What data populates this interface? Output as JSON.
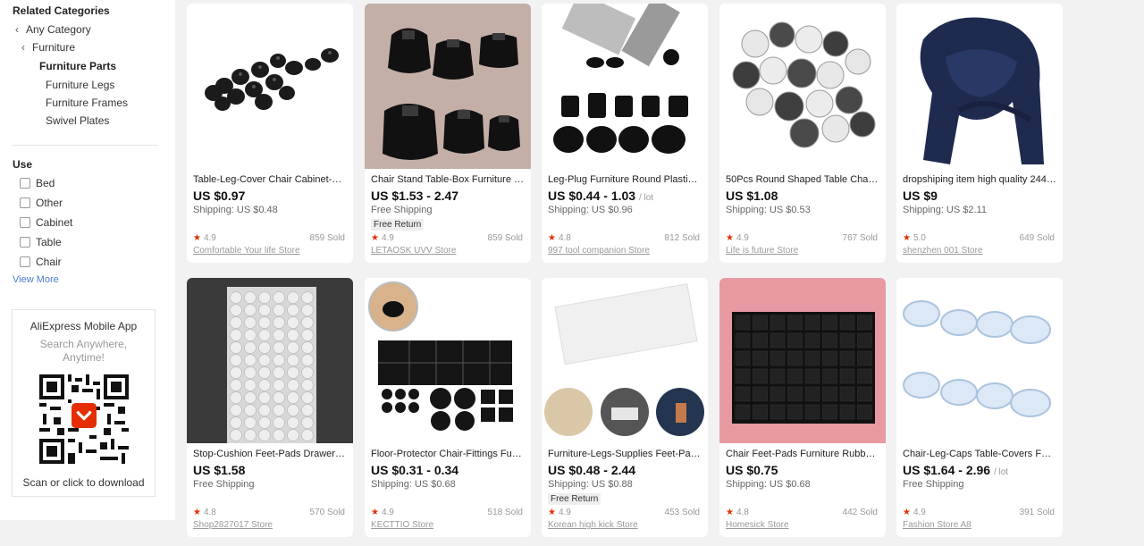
{
  "sidebar": {
    "related_title": "Related Categories",
    "categories": [
      {
        "label": "Any Category"
      },
      {
        "label": "Furniture"
      },
      {
        "label": "Furniture Parts"
      },
      {
        "label": "Furniture Legs"
      },
      {
        "label": "Furniture Frames"
      },
      {
        "label": "Swivel Plates"
      }
    ],
    "use_title": "Use",
    "use_options": [
      {
        "label": "Bed"
      },
      {
        "label": "Other"
      },
      {
        "label": "Cabinet"
      },
      {
        "label": "Table"
      },
      {
        "label": "Chair"
      }
    ],
    "view_more": "View More",
    "app": {
      "title": "AliExpress Mobile App",
      "subtitle": "Search Anywhere, Anytime!",
      "footer": "Scan or click to download"
    }
  },
  "products": [
    {
      "title": "Table-Leg-Cover Chair Cabinet-Bot…",
      "price": "US $0.97",
      "lot": "",
      "shipping": "Shipping: US $0.48",
      "free_return": "",
      "rating": "4.9",
      "sold": "859 Sold",
      "store": "Comfortable Your life Store",
      "image": "black-rubber-feet"
    },
    {
      "title": "Chair Stand Table-Box Furniture S…",
      "price": "US $1.53 - 2.47",
      "lot": "",
      "shipping": "Free Shipping",
      "free_return": "Free Return",
      "rating": "4.9",
      "sold": "859 Sold",
      "store": "LETAOSK UVV Store",
      "image": "black-cone-feet"
    },
    {
      "title": "Leg-Plug Furniture Round Plastic P…",
      "price": "US $0.44 - 1.03",
      "lot": "/ lot",
      "shipping": "Shipping: US $0.96",
      "free_return": "",
      "rating": "4.8",
      "sold": "812 Sold",
      "store": "997 tool companion Store",
      "image": "tube-plugs"
    },
    {
      "title": "50Pcs Round Shaped Table Chair F…",
      "price": "US $1.08",
      "lot": "",
      "shipping": "Shipping: US $0.53",
      "free_return": "",
      "rating": "4.9",
      "sold": "767 Sold",
      "store": "Life is future Store",
      "image": "felt-pads"
    },
    {
      "title": "dropshiping item high quality 244c…",
      "price": "US $9",
      "lot": "",
      "shipping": "Shipping: US $2.11",
      "free_return": "",
      "rating": "5.0",
      "sold": "649 Sold",
      "store": "shenzhen 001 Store",
      "image": "navy-scarf"
    },
    {
      "title": "Stop-Cushion Feet-Pads Drawer-C…",
      "price": "US $1.58",
      "lot": "",
      "shipping": "Free Shipping",
      "free_return": "",
      "rating": "4.8",
      "sold": "570 Sold",
      "store": "Shop2827017 Store",
      "image": "clear-bumper-sheet"
    },
    {
      "title": "Floor-Protector Chair-Fittings Furni…",
      "price": "US $0.31 - 0.34",
      "lot": "",
      "shipping": "Shipping: US $0.68",
      "free_return": "",
      "rating": "4.9",
      "sold": "518 Sold",
      "store": "KECTTIO Store",
      "image": "felt-pad-sheet"
    },
    {
      "title": "Furniture-Legs-Supplies Feet-Pads …",
      "price": "US $0.48 - 2.44",
      "lot": "",
      "shipping": "Shipping: US $0.88",
      "free_return": "Free Return",
      "rating": "4.9",
      "sold": "453 Sold",
      "store": "Korean high kick Store",
      "image": "clear-bumpers-examples"
    },
    {
      "title": "Chair Feet-Pads Furniture Rubber …",
      "price": "US $0.75",
      "lot": "",
      "shipping": "Shipping: US $0.68",
      "free_return": "",
      "rating": "4.8",
      "sold": "442 Sold",
      "store": "Homesick Store",
      "image": "black-square-pads"
    },
    {
      "title": "Chair-Leg-Caps Table-Covers Feet-…",
      "price": "US $1.64 - 2.96",
      "lot": "/ lot",
      "shipping": "Free Shipping",
      "free_return": "",
      "rating": "4.9",
      "sold": "391 Sold",
      "store": "Fashion Store A8",
      "image": "clear-leg-caps"
    }
  ],
  "colors": {
    "accent_star": "#e62e04",
    "link": "#4a7bc8"
  }
}
